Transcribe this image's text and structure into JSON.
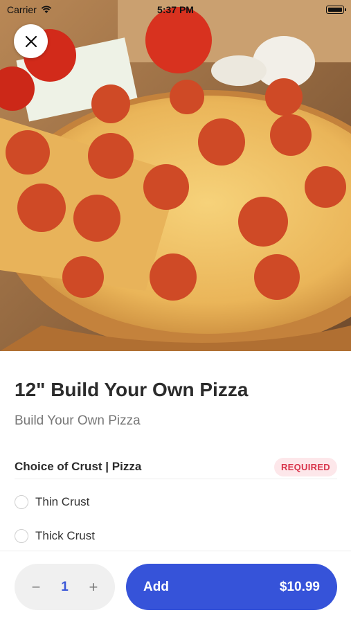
{
  "status_bar": {
    "carrier": "Carrier",
    "time": "5:37 PM"
  },
  "hero": {
    "image_icon": "pepperoni-pizza-photo"
  },
  "item": {
    "title": "12\" Build Your Own Pizza",
    "subtitle": "Build Your Own Pizza"
  },
  "section": {
    "title": "Choice of Crust | Pizza",
    "badge": "REQUIRED",
    "options": [
      {
        "label": "Thin Crust",
        "selected": false
      },
      {
        "label": "Thick Crust",
        "selected": false
      }
    ]
  },
  "cart": {
    "quantity": "1",
    "decrement_label": "−",
    "increment_label": "+",
    "add_label": "Add",
    "price": "$10.99"
  },
  "colors": {
    "accent": "#3653d9",
    "required_text": "#d8334a",
    "required_bg": "#fde7ea"
  }
}
